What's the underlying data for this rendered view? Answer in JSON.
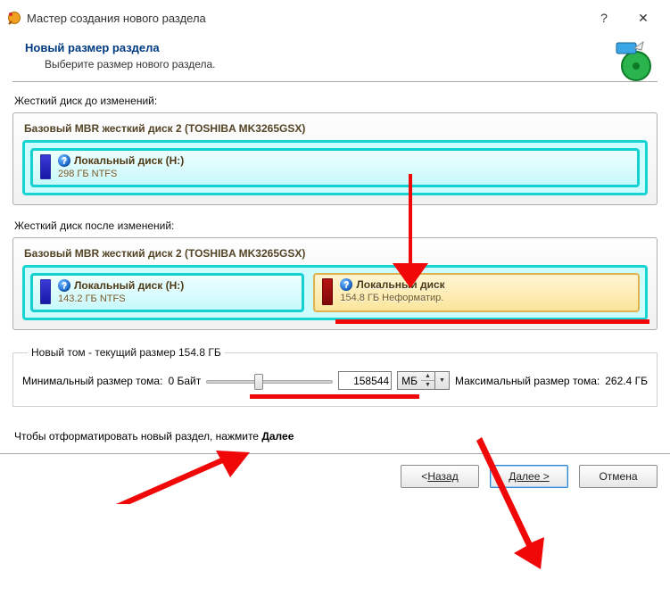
{
  "window": {
    "title": "Мастер создания нового раздела"
  },
  "header": {
    "title": "Новый размер раздела",
    "subtitle": "Выберите размер нового раздела."
  },
  "before": {
    "label": "Жесткий диск до изменений:",
    "disk_header": "Базовый MBR жесткий диск 2 (TOSHIBA MK3265GSX)",
    "part1": {
      "name": "Локальный диск (H:)",
      "details": "298 ГБ NTFS"
    }
  },
  "after": {
    "label": "Жесткий диск после изменений:",
    "disk_header": "Базовый MBR жесткий диск 2 (TOSHIBA MK3265GSX)",
    "part1": {
      "name": "Локальный диск (H:)",
      "details": "143.2 ГБ NTFS"
    },
    "part2": {
      "name": "Локальный диск",
      "details": "154.8 ГБ Неформатир."
    }
  },
  "sizer": {
    "legend": "Новый том - текущий размер 154.8 ГБ",
    "min_label": "Минимальный размер тома:",
    "min_value": "0 Байт",
    "value": "158544",
    "unit": "МБ",
    "max_label": "Максимальный размер тома:",
    "max_value": "262.4 ГБ"
  },
  "hint": {
    "text": "Чтобы отформатировать новый раздел, нажмите ",
    "link": "Далее"
  },
  "buttons": {
    "back": "Назад",
    "next": "Далее >",
    "cancel": "Отмена"
  }
}
